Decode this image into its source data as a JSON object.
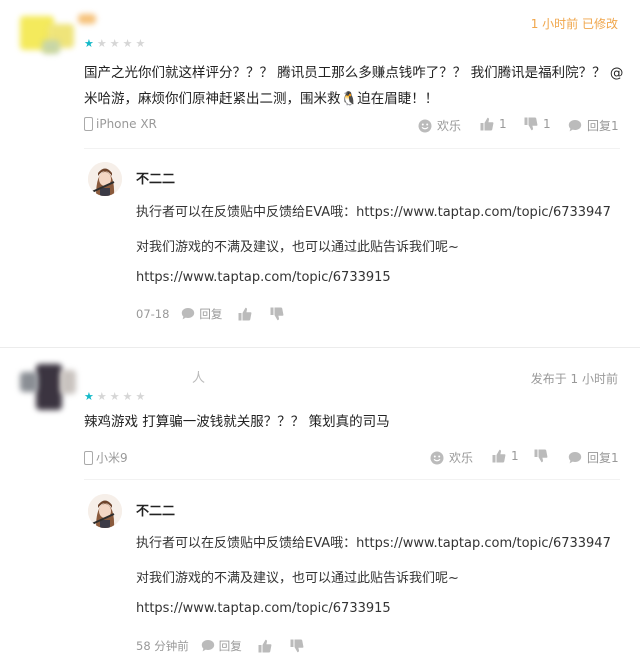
{
  "reviews": [
    {
      "time": "1 小时前 已修改",
      "stars": 1,
      "content": "国产之光你们就这样评分？？？ 腾讯员工那么多赚点钱咋了？？ 我们腾讯是福利院？？ @米哈游，麻烦你们原神赶紧出二测，围米救🐧迫在眉睫！！",
      "device": "iPhone XR",
      "fun_label": "欢乐",
      "like_count": "1",
      "dislike_count": "1",
      "reply_label": "回复1",
      "reply": {
        "name": "不二二",
        "line1": "执行者可以在反馈贴中反馈给EVA哦：https://www.taptap.com/topic/6733947",
        "line2": "对我们游戏的不满及建议，也可以通过此贴告诉我们呢~",
        "line3": "https://www.taptap.com/topic/6733915",
        "date": "07-18",
        "reply_label": "回复"
      }
    },
    {
      "time": "发布于 1 小时前",
      "stars": 1,
      "name_fragment": "人",
      "content": "辣鸡游戏 打算骗一波钱就关服？？？  策划真的司马",
      "device": "小米9",
      "fun_label": "欢乐",
      "like_count": "1",
      "reply_label": "回复1",
      "reply": {
        "name": "不二二",
        "line1": "执行者可以在反馈贴中反馈给EVA哦：https://www.taptap.com/topic/6733947",
        "line2": "对我们游戏的不满及建议，也可以通过此贴告诉我们呢~",
        "line3": "https://www.taptap.com/topic/6733915",
        "date": "58 分钟前",
        "reply_label": "回复"
      }
    }
  ],
  "colors": {
    "accent_teal": "#14b9c8",
    "accent_orange": "#f0a64b",
    "muted": "#999999"
  },
  "icons": [
    "phone-icon",
    "smile-icon",
    "thumb-up-icon",
    "thumb-down-icon",
    "comment-icon"
  ]
}
